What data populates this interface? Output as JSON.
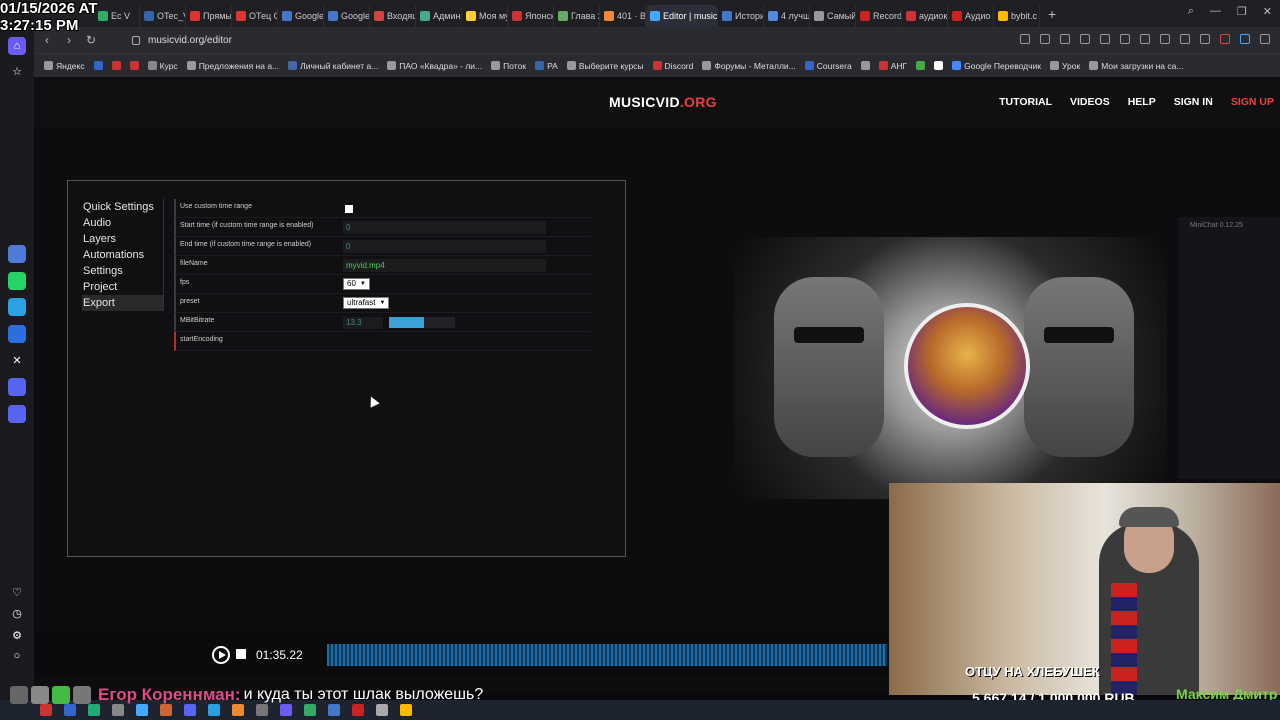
{
  "overlay": {
    "date": "01/15/2026 AT",
    "time": "3:27:15 PM"
  },
  "browser": {
    "tabs": [
      {
        "label": "Ec V",
        "color": "#3a6"
      },
      {
        "label": "OTec_V",
        "color": "#36a"
      },
      {
        "label": "Прямы",
        "color": "#d33"
      },
      {
        "label": "ОТец С",
        "color": "#d33"
      },
      {
        "label": "Google",
        "color": "#47c"
      },
      {
        "label": "Google",
        "color": "#47c"
      },
      {
        "label": "Входящ",
        "color": "#c44"
      },
      {
        "label": "Админ",
        "color": "#4a8"
      },
      {
        "label": "Моя му",
        "color": "#fc3"
      },
      {
        "label": "Японск",
        "color": "#c33"
      },
      {
        "label": "Глава 2",
        "color": "#6a6"
      },
      {
        "label": "401 · В",
        "color": "#e83"
      },
      {
        "label": "Editor | music",
        "color": "#4af",
        "active": true
      },
      {
        "label": "Истори",
        "color": "#47c"
      },
      {
        "label": "4 лучш",
        "color": "#58d"
      },
      {
        "label": "Самый",
        "color": "#999"
      },
      {
        "label": "Record",
        "color": "#c22"
      },
      {
        "label": "аудиок",
        "color": "#c33"
      },
      {
        "label": "Аудио",
        "color": "#c22"
      },
      {
        "label": "bybit.c",
        "color": "#fb0"
      }
    ],
    "url": "musicvid.org/editor",
    "bookmarks": [
      {
        "label": "Яндекс",
        "color": "#999"
      },
      {
        "label": "",
        "color": "#36c"
      },
      {
        "label": "",
        "color": "#c33"
      },
      {
        "label": "",
        "color": "#c33"
      },
      {
        "label": "Курс",
        "color": "#888"
      },
      {
        "label": "Предложения на а...",
        "color": "#999"
      },
      {
        "label": "Личный кабинет а...",
        "color": "#46a"
      },
      {
        "label": "ПАО «Квадра» - ли...",
        "color": "#999"
      },
      {
        "label": "Поток",
        "color": "#999"
      },
      {
        "label": "РА",
        "color": "#36a"
      },
      {
        "label": "Выберите курсы",
        "color": "#999"
      },
      {
        "label": "Discord",
        "color": "#c33"
      },
      {
        "label": "Форумы - Металли...",
        "color": "#999"
      },
      {
        "label": "Coursera",
        "color": "#36c"
      },
      {
        "label": "",
        "color": "#999"
      },
      {
        "label": "АНГ",
        "color": "#c33"
      },
      {
        "label": "",
        "color": "#4a4"
      },
      {
        "label": "",
        "color": "#fff"
      },
      {
        "label": "Google Переводчик",
        "color": "#48f"
      },
      {
        "label": "Урок",
        "color": "#999"
      },
      {
        "label": "Мои загрузки на са...",
        "color": "#999"
      }
    ]
  },
  "site": {
    "logo_main": "MUSICVID",
    "logo_suffix": ".ORG",
    "nav": [
      "TUTORIAL",
      "VIDEOS",
      "HELP",
      "SIGN IN"
    ],
    "signup": "SIGN UP"
  },
  "editor": {
    "menu": [
      {
        "label": "Quick Settings"
      },
      {
        "label": "Audio"
      },
      {
        "label": "Layers"
      },
      {
        "label": "Automations"
      },
      {
        "label": "Settings"
      },
      {
        "label": "Project"
      },
      {
        "label": "Export",
        "active": true
      }
    ],
    "fields": {
      "use_custom_range": {
        "label": "Use custom time range",
        "checked": false
      },
      "start_time": {
        "label": "Start time (if custom time range is enabled)",
        "value": "0"
      },
      "end_time": {
        "label": "End time (if custom time range is enabled)",
        "value": "0"
      },
      "filename": {
        "label": "fileName",
        "value": "myvid.mp4"
      },
      "fps": {
        "label": "fps",
        "value": "60"
      },
      "preset": {
        "label": "preset",
        "value": "ultrafast"
      },
      "bitrate": {
        "label": "MBitBitrate",
        "value": "13.3",
        "fill": 0.53
      },
      "start_encoding": {
        "label": "startEncoding"
      }
    }
  },
  "minichat": {
    "label": "MiniChat 0.12.25"
  },
  "player": {
    "time": "01:35.22"
  },
  "stream": {
    "donation_title": "ОТЦУ НА ХЛЕБУШЕК",
    "donation_amount": "5 667.14 / 1 000 000 RUB",
    "donor_name": "Максим Дмитр",
    "chat_user": "Егор Кореннман:",
    "chat_message": "и куда ты этот шлак выложешь?"
  }
}
